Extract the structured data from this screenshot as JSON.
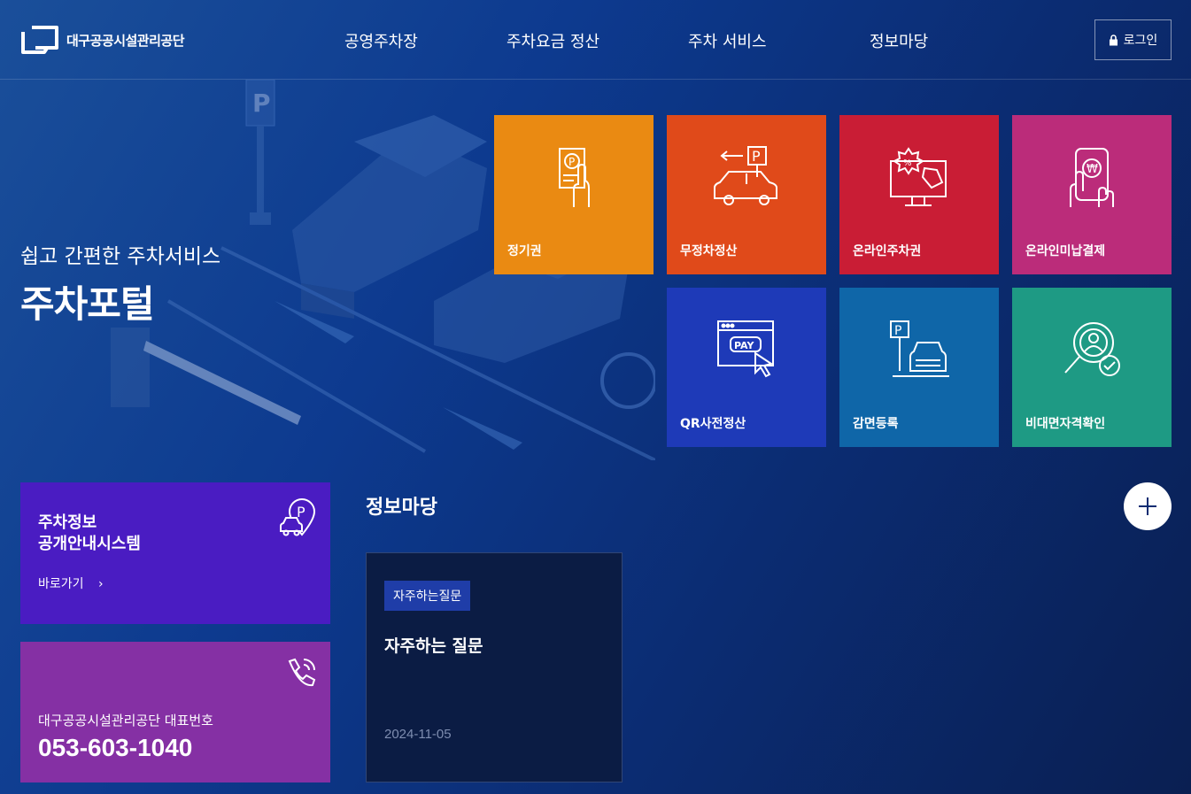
{
  "header": {
    "logo_text": "대구공공시설관리공단",
    "nav": [
      "공영주차장",
      "주차요금 정산",
      "주차 서비스",
      "정보마당"
    ],
    "login_label": "로그인"
  },
  "hero": {
    "subtitle": "쉽고 간편한 주차서비스",
    "title": "주차포털"
  },
  "tiles": [
    {
      "label": "정기권",
      "color": "#ea8a12",
      "icon": "parking-pass-icon"
    },
    {
      "label": "무정차정산",
      "color": "#e04a1a",
      "icon": "car-parking-icon"
    },
    {
      "label": "온라인주차권",
      "color": "#c91d35",
      "icon": "discount-monitor-icon"
    },
    {
      "label": "온라인미납결제",
      "color": "#bb2c7a",
      "icon": "mobile-pay-icon"
    },
    {
      "label": "QR사전정산",
      "color": "#1e3ab8",
      "icon": "pay-window-icon"
    },
    {
      "label": "감면등록",
      "color": "#0f66a8",
      "icon": "parked-car-icon"
    },
    {
      "label": "비대면자격확인",
      "color": "#1e9a84",
      "icon": "identity-check-icon"
    }
  ],
  "parking_card": {
    "title_line1": "주차정보",
    "title_line2": "공개안내시스템",
    "link_label": "바로가기"
  },
  "phone_card": {
    "label": "대구공공시설관리공단 대표번호",
    "number": "053-603-1040"
  },
  "info": {
    "title": "정보마당",
    "faq_badge": "자주하는질문",
    "faq_title": "자주하는 질문",
    "faq_date": "2024-11-05"
  }
}
